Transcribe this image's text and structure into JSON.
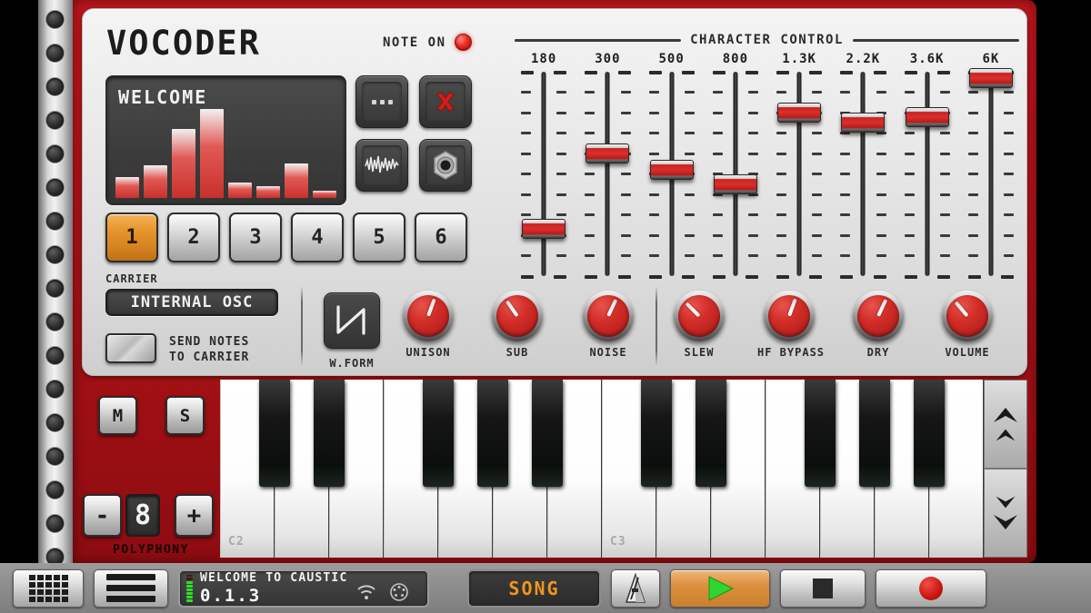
{
  "app": {
    "title": "VOCODER",
    "note_on_label": "NOTE ON",
    "note_on_active": true,
    "accent_red": "#c9221f",
    "accent_orange": "#e7952c",
    "chassis_red": "#a81116"
  },
  "display": {
    "preset_name": "WELCOME",
    "bars": [
      22,
      34,
      72,
      93,
      16,
      12,
      36,
      8
    ]
  },
  "icon_buttons": [
    {
      "name": "more-options-button",
      "icon": "ellipsis-icon",
      "label": "..."
    },
    {
      "name": "delete-button",
      "icon": "x-close-icon",
      "label": "X"
    },
    {
      "name": "waveform-button",
      "icon": "waveform-icon",
      "label": "waveform"
    },
    {
      "name": "audio-jack-button",
      "icon": "audio-jack-icon",
      "label": "jack"
    }
  ],
  "presets": [
    {
      "label": "1",
      "active": true
    },
    {
      "label": "2",
      "active": false
    },
    {
      "label": "3",
      "active": false
    },
    {
      "label": "4",
      "active": false
    },
    {
      "label": "5",
      "active": false
    },
    {
      "label": "6",
      "active": false
    }
  ],
  "carrier": {
    "section_label": "CARRIER",
    "selected": "INTERNAL OSC",
    "send_notes_line1": "SEND NOTES",
    "send_notes_line2": "TO CARRIER",
    "send_notes_enabled": false
  },
  "waveform": {
    "label": "W.FORM",
    "shape": "sawtooth"
  },
  "knobs": [
    {
      "label": "UNISON",
      "angle": 200
    },
    {
      "label": "SUB",
      "angle": 145
    },
    {
      "label": "NOISE",
      "angle": 205
    },
    {
      "label": "SLEW",
      "angle": 135
    },
    {
      "label": "HF BYPASS",
      "angle": 200
    },
    {
      "label": "DRY",
      "angle": 205
    },
    {
      "label": "VOLUME",
      "angle": 140
    }
  ],
  "vu_meter": {
    "segments": 13,
    "lit": 10,
    "colors": {
      "green": "#2ae02a",
      "yellow": "#6b6b12",
      "red": "#4a1512"
    }
  },
  "character_control": {
    "title": "CHARACTER CONTROL",
    "bands": [
      {
        "label": "180",
        "value": 23
      },
      {
        "label": "300",
        "value": 60
      },
      {
        "label": "500",
        "value": 52
      },
      {
        "label": "800",
        "value": 45
      },
      {
        "label": "1.3K",
        "value": 80
      },
      {
        "label": "2.2K",
        "value": 75
      },
      {
        "label": "3.6K",
        "value": 78
      },
      {
        "label": "6K",
        "value": 97
      }
    ],
    "tick_count": 10
  },
  "keyboard": {
    "mute_label": "M",
    "solo_label": "S",
    "polyphony_label": "POLYPHONY",
    "polyphony_minus": "-",
    "polyphony_value": "8",
    "polyphony_plus": "+",
    "key_labels": [
      {
        "name": "C2",
        "index": 0
      },
      {
        "name": "C3",
        "index": 7
      }
    ],
    "white_key_count": 14,
    "octave_up_label": "octave-up",
    "octave_down_label": "octave-down"
  },
  "transport": {
    "grid_button": "grid-view-button",
    "menu_button": "menu-button",
    "project_title": "WELCOME TO CAUSTIC",
    "version": "0.1.3",
    "wifi_icon": "wifi-icon",
    "midi_icon": "midi-din-icon",
    "song_label": "SONG",
    "metronome_label": "metronome",
    "play_label": "play",
    "stop_label": "stop",
    "record_label": "record"
  }
}
